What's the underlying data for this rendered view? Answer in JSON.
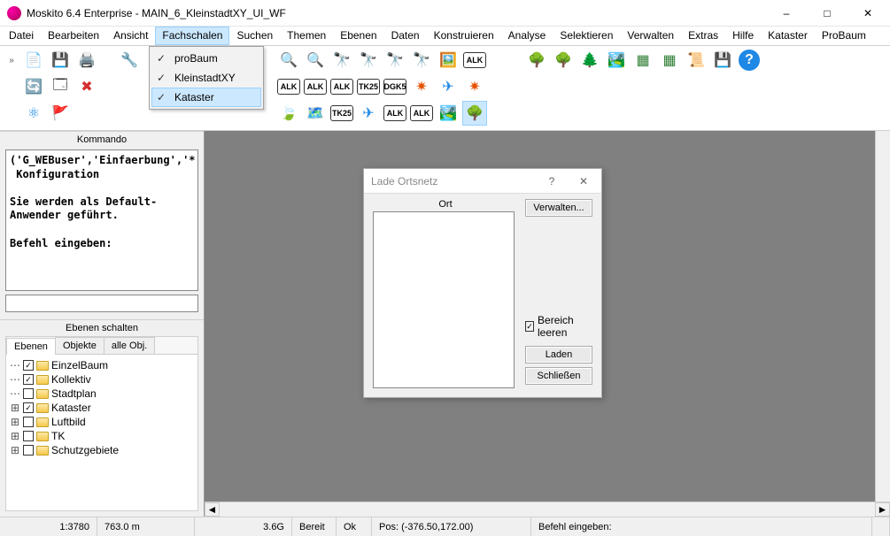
{
  "window": {
    "title": "Moskito 6.4 Enterprise - MAIN_6_KleinstadtXY_UI_WF"
  },
  "menubar": {
    "items": [
      "Datei",
      "Bearbeiten",
      "Ansicht",
      "Fachschalen",
      "Suchen",
      "Themen",
      "Ebenen",
      "Daten",
      "Konstruieren",
      "Analyse",
      "Selektieren",
      "Verwalten",
      "Extras",
      "Hilfe",
      "Kataster",
      "ProBaum"
    ],
    "active_index": 3
  },
  "dropdown": {
    "items": [
      {
        "label": "proBaum",
        "checked": true
      },
      {
        "label": "KleinstadtXY",
        "checked": true
      },
      {
        "label": "Kataster",
        "checked": true
      }
    ],
    "hover_index": 2
  },
  "toolbar": {
    "alk": "ALK",
    "tk25": "TK25",
    "dgk5": "DGK5"
  },
  "panels": {
    "kommando_title": "Kommando",
    "kommando_text": "('G_WEBuser','Einfaerbung','*')\n Konfiguration\n\nSie werden als Default-Anwender geführt.\n\nBefehl eingeben:",
    "layers_title": "Ebenen schalten",
    "tabs": [
      "Ebenen",
      "Objekte",
      "alle Obj."
    ],
    "active_tab": 0,
    "tree": [
      {
        "label": "EinzelBaum",
        "checked": true,
        "expandable": false
      },
      {
        "label": "Kollektiv",
        "checked": true,
        "expandable": false
      },
      {
        "label": "Stadtplan",
        "checked": false,
        "expandable": false
      },
      {
        "label": "Kataster",
        "checked": true,
        "expandable": true
      },
      {
        "label": "Luftbild",
        "checked": false,
        "expandable": true
      },
      {
        "label": "TK",
        "checked": false,
        "expandable": true
      },
      {
        "label": "Schutzgebiete",
        "checked": false,
        "expandable": true
      }
    ]
  },
  "dialog": {
    "title": "Lade Ortsnetz",
    "ort_label": "Ort",
    "verwalten": "Verwalten...",
    "bereich_leeren": "Bereich leeren",
    "bereich_checked": true,
    "laden": "Laden",
    "schliessen": "Schließen"
  },
  "status": {
    "scale": "1:3780",
    "dist": "763.0 m",
    "mem": "3.6G",
    "state": "Bereit",
    "ok": "Ok",
    "pos": "Pos: (-376.50,172.00)",
    "prompt": "Befehl eingeben:"
  }
}
